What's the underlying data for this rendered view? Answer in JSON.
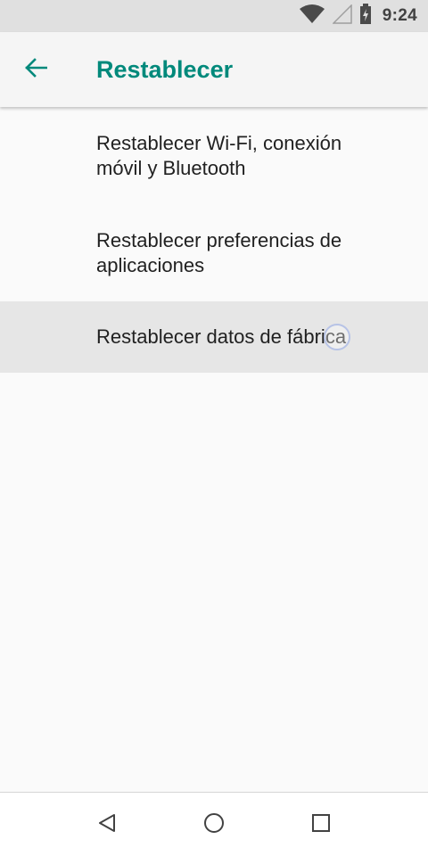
{
  "status_bar": {
    "time": "9:24",
    "icons": [
      "wifi-icon",
      "cell-signal-icon",
      "battery-icon"
    ]
  },
  "app_bar": {
    "back_icon": "arrow-back-icon",
    "title": "Restablecer",
    "accent_color": "#00897b"
  },
  "list": {
    "items": [
      {
        "label": "Restablecer Wi-Fi, conexión\nmóvil y Bluetooth"
      },
      {
        "label": "Restablecer preferencias de\naplicaciones"
      },
      {
        "label": "Restablecer datos de fábrica"
      }
    ]
  },
  "nav_bar": {
    "buttons": [
      "back-triangle-icon",
      "home-circle-icon",
      "recents-square-icon"
    ]
  }
}
